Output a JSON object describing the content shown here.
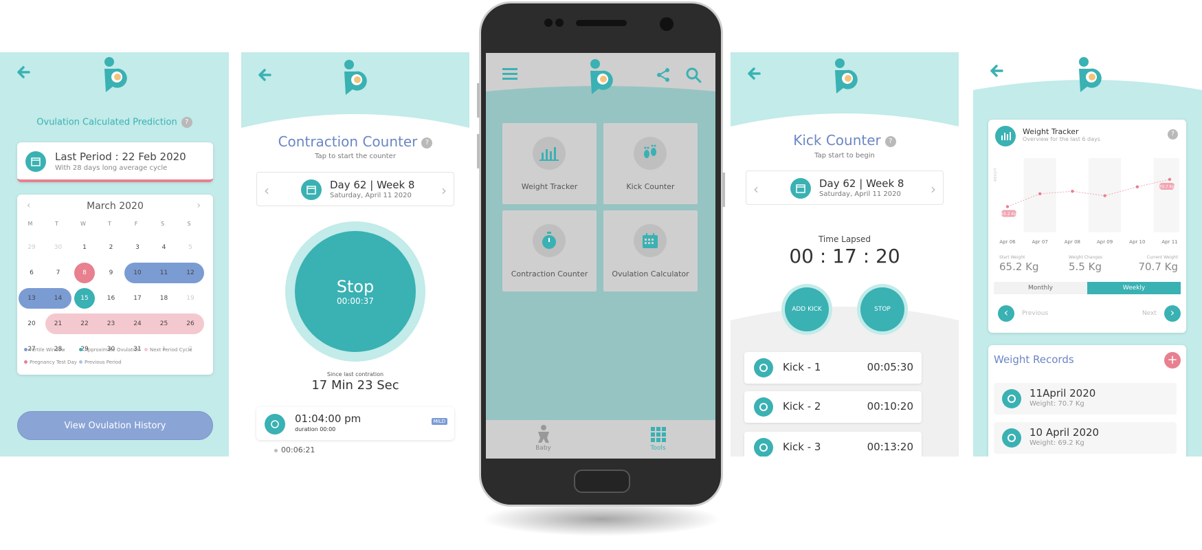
{
  "colors": {
    "teal": "#3ab1b3",
    "light_teal": "#c2ebe9",
    "blue": "#7b9bd3",
    "pink": "#f4c8cf",
    "red": "#e8808f"
  },
  "ovulation": {
    "title": "Ovulation Calculated Prediction",
    "last_period": "Last Period : 22 Feb 2020",
    "cycle_note": "With 28 days long average cycle",
    "month": "March 2020",
    "weekdays": [
      "M",
      "T",
      "W",
      "T",
      "F",
      "S",
      "S"
    ],
    "weeks": [
      [
        "29",
        "30",
        "1",
        "2",
        "3",
        "4",
        "5"
      ],
      [
        "6",
        "7",
        "8",
        "9",
        "10",
        "11",
        "12"
      ],
      [
        "13",
        "14",
        "15",
        "16",
        "17",
        "18",
        "19"
      ],
      [
        "20",
        "21",
        "22",
        "23",
        "24",
        "25",
        "26"
      ],
      [
        "27",
        "28",
        "29",
        "30",
        "31",
        "1",
        "2"
      ]
    ],
    "legend": [
      "Fertile Window",
      "Approximate Ovulation",
      "Next Period Cycle",
      "Pregnancy Test Day",
      "Previous Period"
    ],
    "history_button": "View Ovulation History"
  },
  "contraction": {
    "title": "Contraction Counter",
    "subtitle": "Tap to start the counter",
    "day": "Day 62 | Week 8",
    "date": "Saturday, April 11 2020",
    "stop_label": "Stop",
    "stop_time": "00:00:37",
    "since_label": "Since last contration",
    "since_value": "17 Min 23 Sec",
    "entry_time": "01:04:00 pm",
    "entry_duration": "duration 00:00",
    "entry_badge": "MILD",
    "interval": "00:06:21"
  },
  "tools": {
    "tiles": [
      "Weight Tracker",
      "Kick Counter",
      "Contraction Counter",
      "Ovulation Calculator"
    ],
    "nav": [
      "Baby",
      "Tools"
    ]
  },
  "kick": {
    "title": "Kick Counter",
    "subtitle": "Tap start to begin",
    "day": "Day 62 | Week 8",
    "date": "Saturday, April 11 2020",
    "lapsed_label": "Time Lapsed",
    "lapsed_value": "00 : 17 : 20",
    "add_button": "ADD KICK",
    "stop_button": "STOP",
    "kicks": [
      {
        "name": "Kick - 1",
        "time": "00:05:30"
      },
      {
        "name": "Kick - 2",
        "time": "00:10:20"
      },
      {
        "name": "Kick - 3",
        "time": "00:13:20"
      }
    ]
  },
  "weight": {
    "title": "Weight Tracker",
    "subtitle": "Overview for the last 6 days",
    "y_label": "WEIGHT",
    "start_label": "Start Weight",
    "start_value": "65.2 Kg",
    "change_label": "Weight Changes",
    "change_value": "5.5 Kg",
    "current_label": "Current Weight",
    "current_value": "70.7 Kg",
    "tab_monthly": "Monthly",
    "tab_weekly": "Weekly",
    "prev": "Previous",
    "next": "Next",
    "records_title": "Weight Records",
    "records": [
      {
        "date": "11April 2020",
        "weight": "Weight: 70.7 Kg"
      },
      {
        "date": "10 April 2020",
        "weight": "Weight: 69.2 Kg"
      }
    ]
  },
  "chart_data": {
    "type": "line",
    "title": "Weight Tracker",
    "subtitle": "Overview for the last 6 days",
    "ylabel": "WEIGHT",
    "categories": [
      "Apr 06",
      "Apr 07",
      "Apr 08",
      "Apr 09",
      "Apr 10",
      "Apr 11"
    ],
    "values": [
      65.2,
      67.8,
      68.3,
      67.4,
      69.2,
      70.7
    ],
    "labels": [
      "65.2 Kg",
      "70.7 Kg"
    ],
    "ylim": [
      60,
      75
    ],
    "grid": false
  }
}
